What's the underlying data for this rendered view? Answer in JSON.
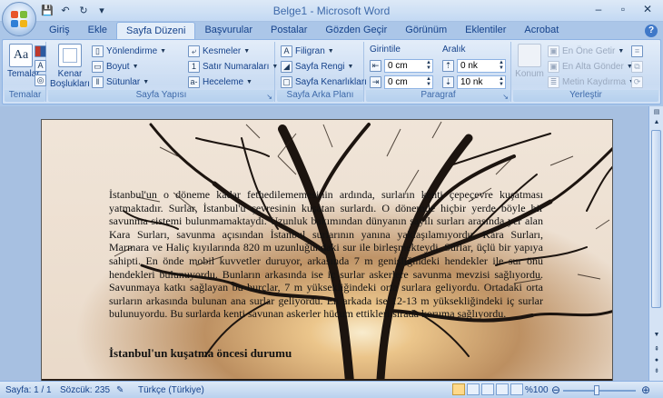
{
  "window": {
    "title": "Belge1 - Microsoft Word",
    "minimize": "–",
    "maximize": "▫",
    "close": "✕"
  },
  "qat": {
    "save": "💾",
    "undo": "↶",
    "redo": "↻",
    "customize": "▾"
  },
  "tabs": [
    {
      "label": "Giriş"
    },
    {
      "label": "Ekle"
    },
    {
      "label": "Sayfa Düzeni",
      "active": true
    },
    {
      "label": "Başvurular"
    },
    {
      "label": "Postalar"
    },
    {
      "label": "Gözden Geçir"
    },
    {
      "label": "Görünüm"
    },
    {
      "label": "Eklentiler"
    },
    {
      "label": "Acrobat"
    }
  ],
  "ribbon": {
    "temalar": {
      "button_label": "Temalar",
      "group_label": "Temalar"
    },
    "sayfa_yapisi": {
      "kenar_label": "Kenar Boşlukları",
      "yonlendirme": "Yönlendirme",
      "boyut": "Boyut",
      "sutunlar": "Sütunlar",
      "kesmeler": "Kesmeler",
      "satir_numaralari": "Satır Numaraları",
      "heceleme": "Heceleme",
      "group_label": "Sayfa Yapısı"
    },
    "sayfa_arka_plani": {
      "filigran": "Filigran",
      "sayfa_rengi": "Sayfa Rengi",
      "sayfa_kenarliklari": "Sayfa Kenarlıkları",
      "group_label": "Sayfa Arka Planı"
    },
    "paragraf": {
      "girinti_label": "Girintile",
      "aralik_label": "Aralık",
      "girinti_sol": "0 cm",
      "girinti_sag": "0 cm",
      "aralik_once": "0 nk",
      "aralik_sonra": "10 nk",
      "group_label": "Paragraf"
    },
    "yerlestir": {
      "konum": "Konum",
      "en_one_getir": "En Öne Getir",
      "en_alta_gonder": "En Alta Gönder",
      "metin_kaydirma": "Metin Kaydırma",
      "group_label": "Yerleştir"
    }
  },
  "document": {
    "paragraph": "İstanbul'un o döneme kadar fethedilememesinin ardında, surların kenti çepeçevre kuşatması yatmaktadır. Surlar, İstanbul'u çevresinin kuşatan surlardı. O dönemde hiçbir yerde böyle bir savunma sistemi bulunmamaktaydı. Uzunluk bakımından dünyanın sayılı surları arasında yer alan Kara Surları, savunma açısından İstanbul surlarının yanına yaklaşılamıyordu. Kara Surları, Marmara ve Haliç kıyılarında 820 m uzunluğundaki sur ile birleşmekteydi. Surlar, üçlü bir yapıya sahipti. En önde mobil kuvvetler duruyor, arkasında 7 m genişliğindeki hendekler ile sur önü hendekleri bulunuyordu. Bunların arkasında ise iç surlar askerlere savunma mevzisi sağlıyordu. Savunmaya katkı sağlayan bu burçlar, 7 m yüksekliğindeki orta surlara geliyordu. Ortadaki orta surların arkasında bulunan ana surlar geliyordu. En arkada ise 12-13 m yüksekliğindeki iç surlar bulunuyordu. Bu surlarda kenti savunan askerler hücum ettikleri sırada koruma sağlıyordu.",
    "heading": "İstanbul'un kuşatma öncesi durumu"
  },
  "statusbar": {
    "sayfa": "Sayfa: 1 / 1",
    "sozcuk": "Sözcük: 235",
    "dil": "Türkçe (Türkiye)",
    "zoom": "%100",
    "zoom_level": 1.0
  },
  "colors": {
    "ribbon_bg": "#dbe7f6",
    "accent": "#15428b"
  }
}
